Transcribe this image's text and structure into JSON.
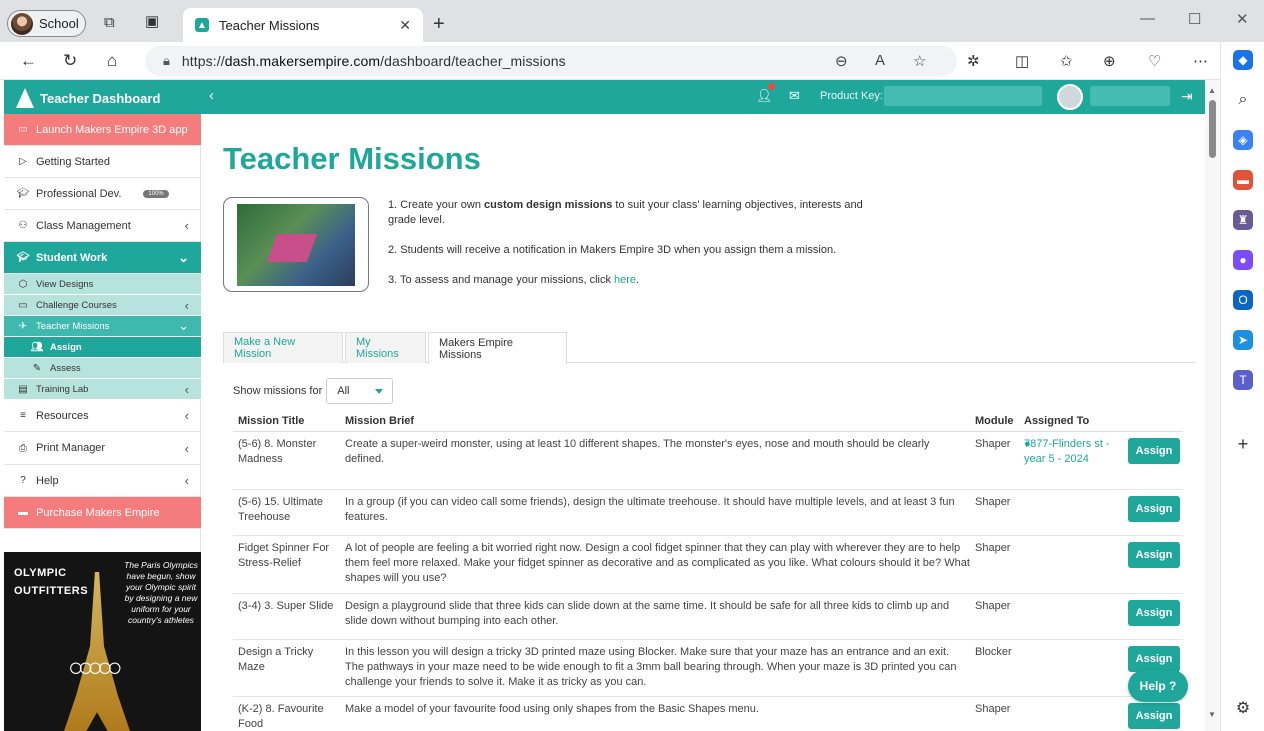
{
  "browser": {
    "profile_label": "School",
    "tab_title": "Teacher Missions",
    "url_prefix": "https://",
    "url_domain": "dash.makersempire.com",
    "url_path": "/dashboard/teacher_missions"
  },
  "header": {
    "brand": "Teacher Dashboard",
    "notification_count": "1",
    "product_key_label": "Product Key:"
  },
  "sidebar": {
    "launch": "Launch Makers Empire 3D app",
    "getting_started": "Getting Started",
    "professional_dev": "Professional Dev.",
    "professional_dev_badge": "100%",
    "class_management": "Class Management",
    "student_work": "Student Work",
    "view_designs": "View Designs",
    "challenge_courses": "Challenge Courses",
    "teacher_missions": "Teacher Missions",
    "assign": "Assign",
    "assess": "Assess",
    "training_lab": "Training Lab",
    "resources": "Resources",
    "print_manager": "Print Manager",
    "help": "Help",
    "purchase": "Purchase Makers Empire",
    "promo_title": "OLYMPIC OUTFITTERS",
    "promo_text": "The Paris Olympics have begun, show your Olympic spirit by designing a new uniform for your country's athletes"
  },
  "main": {
    "title": "Teacher Missions",
    "intro_1_pre": "1. Create your own ",
    "intro_1_bold": "custom design missions",
    "intro_1_post": " to suit your class' learning objectives, interests and grade level.",
    "intro_2": "2. Students will receive a notification in Makers Empire 3D when you assign them a mission.",
    "intro_3_pre": "3. To assess and manage your missions, click ",
    "intro_3_link": "here",
    "intro_3_post": ".",
    "tabs": [
      "Make a New Mission",
      "My Missions",
      "Makers Empire Missions"
    ],
    "filter_label": "Show missions for",
    "filter_value": "All",
    "columns": [
      "Mission Title",
      "Mission Brief",
      "Module",
      "Assigned To"
    ],
    "assign_label": "Assign",
    "help_label": "Help ?",
    "rows": [
      {
        "title": "(5-6) 8. Monster Madness",
        "brief": "Create a super-weird monster, using at least 10 different shapes. The monster's eyes, nose and mouth should be clearly defined.",
        "module": "Shaper",
        "assigned": "7877-Flinders st - year 5 - 2024"
      },
      {
        "title": "(5-6) 15. Ultimate Treehouse",
        "brief": "In a group (if you can video call some friends), design the ultimate treehouse. It should have multiple levels, and at least 3 fun features.",
        "module": "Shaper",
        "assigned": ""
      },
      {
        "title": "Fidget Spinner For Stress-Relief",
        "brief": "A lot of people are feeling a bit worried right now. Design a cool fidget spinner that they can play with wherever they are to help them feel more relaxed. Make your fidget spinner as decorative and as complicated as you like. What colours should it be? What shapes will you use?",
        "module": "Shaper",
        "assigned": ""
      },
      {
        "title": "(3-4) 3. Super Slide",
        "brief": "Design a playground slide that three kids can slide down at the same time. It should be safe for all three kids to climb up and slide down without bumping into each other.",
        "module": "Shaper",
        "assigned": ""
      },
      {
        "title": "Design a Tricky Maze",
        "brief": "In this lesson you will design a tricky 3D printed maze using Blocker. Make sure that your maze has an entrance and an exit. The pathways in your maze need to be wide enough to fit a 3mm ball bearing through. When your maze is 3D printed you can challenge your friends to solve it. Make it as tricky as you can.",
        "module": "Blocker",
        "assigned": ""
      },
      {
        "title": "(K-2) 8. Favourite Food",
        "brief": "Make a model of your favourite food using only shapes from the Basic Shapes menu.",
        "module": "Shaper",
        "assigned": ""
      }
    ]
  },
  "colors": {
    "teal": "#1fa79b",
    "pink": "#f47c7c",
    "light_teal": "#b7e3df"
  }
}
